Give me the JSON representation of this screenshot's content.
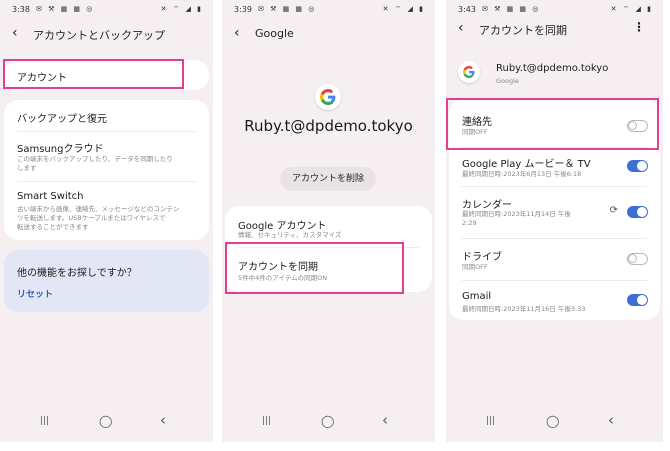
{
  "colors": {
    "accent_blue": "#3d6fd6",
    "highlight_pink": "#e0408f",
    "phone_bg": "#f6eff2",
    "card_bg": "#ffffff"
  },
  "screen1": {
    "status": {
      "time": "3:38",
      "left_icons": "✉ ⚒ ▦ ▦ ◎",
      "right_icons": "✕ ⌔ ◢ ▮"
    },
    "title": "アカウントとバックアップ",
    "account_label": "アカウント",
    "backup_header": "バックアップと復元",
    "samsung_cloud": {
      "title": "Samsungクラウド",
      "sub1": "この端末をバックアップしたり、データを同期したり",
      "sub2": "します"
    },
    "smart_switch": {
      "title": "Smart Switch",
      "sub1": "古い端末から画像、連絡先、メッセージなどのコンテン",
      "sub2": "ツを転送します。USBケーブルまたはワイヤレスで",
      "sub3": "転送することができます"
    },
    "other": {
      "title": "他の機能をお探しですか？",
      "reset": "リセット"
    }
  },
  "screen2": {
    "status": {
      "time": "3:39",
      "left_icons": "✉ ⚒ ▦ ▦ ◎",
      "right_icons": "✕ ⌔ ◢ ▮"
    },
    "title": "Google",
    "email": "Ruby.t@dpdemo.tokyo",
    "remove_button": "アカウントを削除",
    "google_account": {
      "title": "Google アカウント",
      "sub": "情報、セキュリティ、カスタマイズ"
    },
    "sync_account": {
      "title": "アカウントを同期",
      "sub": "5件中4件のアイテムの同期ON"
    }
  },
  "screen3": {
    "status": {
      "time": "3:43",
      "left_icons": "✉ ⚒ ▦ ▦ ◎",
      "right_icons": "✕ ⌔ ◢ ▮"
    },
    "title": "アカウントを同期",
    "email": "Ruby.t@dpdemo.tokyo",
    "provider": "Google",
    "items": [
      {
        "title": "連絡先",
        "sub1": "同期OFF",
        "sub2": "",
        "on": false
      },
      {
        "title": "Google Play ムービー＆ TV",
        "sub1": "最終同期日時:2023年6月13日 午後6:18",
        "sub2": "",
        "on": true
      },
      {
        "title": "カレンダー",
        "sub1": "最終同期日時:2023年11月14日 午後",
        "sub2": "2:29",
        "on": true
      },
      {
        "title": "ドライブ",
        "sub1": "同期OFF",
        "sub2": "",
        "on": false
      },
      {
        "title": "Gmail",
        "sub1": "最終同期日時:2023年11月16日 午後3:33",
        "sub2": "",
        "on": true
      }
    ]
  },
  "nav": {
    "recents": "|||",
    "home": "◯",
    "back": "‹"
  }
}
